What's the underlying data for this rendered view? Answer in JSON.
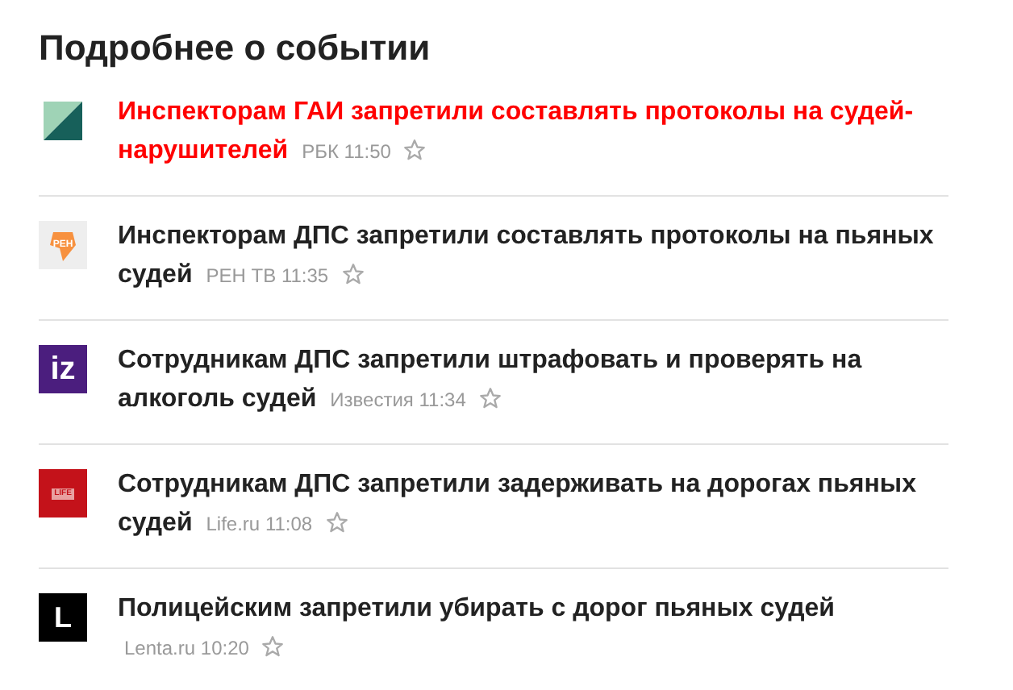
{
  "title": "Подробнее о событии",
  "items": [
    {
      "logo": {
        "kind": "split"
      },
      "headline_lines": [
        "Инспекторам ГАИ запретили составлять протоколы на судей-",
        "нарушителей"
      ],
      "source": "РБК",
      "time": "11:50",
      "highlighted": true,
      "starred": false
    },
    {
      "logo": {
        "kind": "ren",
        "text": "РЕН"
      },
      "headline_lines": [
        "Инспекторам ДПС запретили составлять протоколы на пьяных",
        "судей"
      ],
      "source": "РЕН ТВ",
      "time": "11:35",
      "highlighted": false,
      "starred": false
    },
    {
      "logo": {
        "kind": "iz",
        "text": "iz"
      },
      "headline_lines": [
        "Сотрудникам ДПС запретили штрафовать и проверять на",
        "алкоголь судей"
      ],
      "source": "Известия",
      "time": "11:34",
      "highlighted": false,
      "starred": false
    },
    {
      "logo": {
        "kind": "life",
        "text": "LIFE"
      },
      "headline_lines": [
        "Сотрудникам ДПС запретили задерживать на дорогах пьяных",
        "судей"
      ],
      "source": "Life.ru",
      "time": "11:08",
      "highlighted": false,
      "starred": false
    },
    {
      "logo": {
        "kind": "lenta",
        "text": "L"
      },
      "headline_lines": [
        "Полицейским запретили убирать с дорог пьяных судей"
      ],
      "source": "Lenta.ru",
      "time": "10:20",
      "highlighted": false,
      "starred": false
    }
  ]
}
